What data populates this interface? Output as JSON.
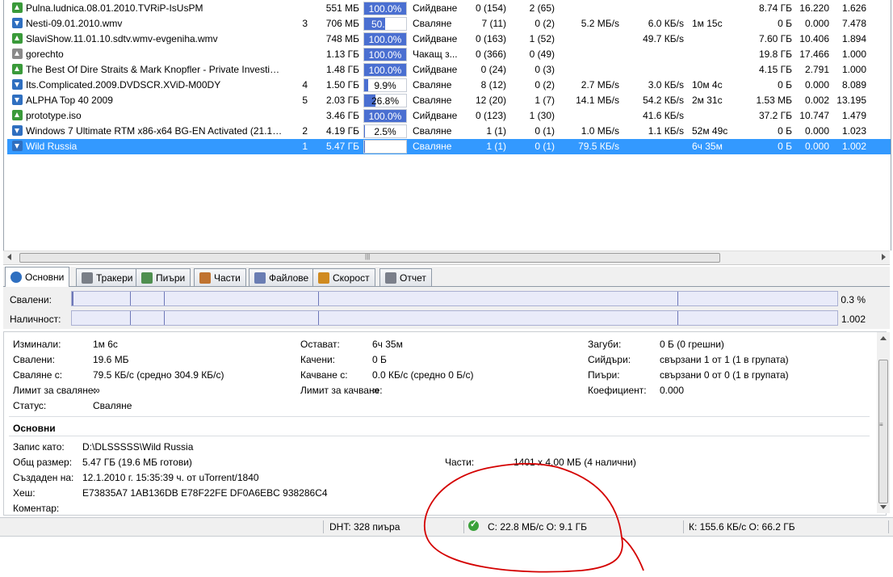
{
  "torrents": [
    {
      "icon": "seed",
      "name": "Pulna.ludnica.08.01.2010.TVRiP-IsUsPM",
      "num": "",
      "size": "551 МБ",
      "progress": "100.0%",
      "progress_pct": 100,
      "status": "Сийдване",
      "seeds": "0 (154)",
      "peers": "2 (65)",
      "dl": "",
      "ul": "",
      "eta": "",
      "downloaded": "8.74 ГБ",
      "uploaded": "16.220",
      "ratio": "1.626"
    },
    {
      "icon": "down",
      "name": "Nesti-09.01.2010.wmv",
      "num": "3",
      "size": "706 МБ",
      "progress": "50.2%",
      "progress_pct": 50.2,
      "status": "Сваляне",
      "seeds": "7 (11)",
      "peers": "0 (2)",
      "dl": "5.2 МБ/s",
      "ul": "6.0 КБ/s",
      "eta": "1м 15с",
      "downloaded": "0 Б",
      "uploaded": "0.000",
      "ratio": "7.478"
    },
    {
      "icon": "seed",
      "name": "SlaviShow.11.01.10.sdtv.wmv-evgeniha.wmv",
      "num": "",
      "size": "748 МБ",
      "progress": "100.0%",
      "progress_pct": 100,
      "status": "Сийдване",
      "seeds": "0 (163)",
      "peers": "1 (52)",
      "dl": "",
      "ul": "49.7 КБ/s",
      "eta": "",
      "downloaded": "7.60 ГБ",
      "uploaded": "10.406",
      "ratio": "1.894"
    },
    {
      "icon": "stop",
      "name": "gorechto",
      "num": "",
      "size": "1.13 ГБ",
      "progress": "100.0%",
      "progress_pct": 100,
      "status": "Чакащ з...",
      "seeds": "0 (366)",
      "peers": "0 (49)",
      "dl": "",
      "ul": "",
      "eta": "",
      "downloaded": "19.8 ГБ",
      "uploaded": "17.466",
      "ratio": "1.000"
    },
    {
      "icon": "seed",
      "name": "The Best Of Dire Straits & Mark Knopfler - Private Investiga...",
      "num": "",
      "size": "1.48 ГБ",
      "progress": "100.0%",
      "progress_pct": 100,
      "status": "Сийдване",
      "seeds": "0 (24)",
      "peers": "0 (3)",
      "dl": "",
      "ul": "",
      "eta": "",
      "downloaded": "4.15 ГБ",
      "uploaded": "2.791",
      "ratio": "1.000"
    },
    {
      "icon": "down",
      "name": "Its.Complicated.2009.DVDSCR.XViD-M00DY",
      "num": "4",
      "size": "1.50 ГБ",
      "progress": "9.9%",
      "progress_pct": 9.9,
      "status": "Сваляне",
      "seeds": "8 (12)",
      "peers": "0 (2)",
      "dl": "2.7 МБ/s",
      "ul": "3.0 КБ/s",
      "eta": "10м 4с",
      "downloaded": "0 Б",
      "uploaded": "0.000",
      "ratio": "8.089"
    },
    {
      "icon": "down",
      "name": "ALPHA Top 40 2009",
      "num": "5",
      "size": "2.03 ГБ",
      "progress": "26.8%",
      "progress_pct": 26.8,
      "status": "Сваляне",
      "seeds": "12 (20)",
      "peers": "1 (7)",
      "dl": "14.1 МБ/s",
      "ul": "54.2 КБ/s",
      "eta": "2м 31с",
      "downloaded": "1.53 МБ",
      "uploaded": "0.002",
      "ratio": "13.195"
    },
    {
      "icon": "seed",
      "name": "prototype.iso",
      "num": "",
      "size": "3.46 ГБ",
      "progress": "100.0%",
      "progress_pct": 100,
      "status": "Сийдване",
      "seeds": "0 (123)",
      "peers": "1 (30)",
      "dl": "",
      "ul": "41.6 КБ/s",
      "eta": "",
      "downloaded": "37.2 ГБ",
      "uploaded": "10.747",
      "ratio": "1.479"
    },
    {
      "icon": "down",
      "name": "Windows 7 Ultimate RTM x86-x64 BG-EN Activated (21.12....",
      "num": "2",
      "size": "4.19 ГБ",
      "progress": "2.5%",
      "progress_pct": 2.5,
      "status": "Сваляне",
      "seeds": "1 (1)",
      "peers": "0 (1)",
      "dl": "1.0 МБ/s",
      "ul": "1.1 КБ/s",
      "eta": "52м 49с",
      "downloaded": "0 Б",
      "uploaded": "0.000",
      "ratio": "1.023"
    },
    {
      "icon": "down",
      "name": "Wild Russia",
      "num": "1",
      "size": "5.47 ГБ",
      "progress": "0.3%",
      "progress_pct": 0.3,
      "status": "Сваляне",
      "seeds": "1 (1)",
      "peers": "0 (1)",
      "dl": "79.5 КБ/s",
      "ul": "",
      "eta": "6ч 35м",
      "downloaded": "0 Б",
      "uploaded": "0.000",
      "ratio": "1.002",
      "selected": true
    }
  ],
  "tabs": [
    {
      "label": "Основни",
      "icon": "info-icon",
      "active": true
    },
    {
      "label": "Тракери",
      "icon": "trackers-icon"
    },
    {
      "label": "Пиъри",
      "icon": "peers-icon"
    },
    {
      "label": "Части",
      "icon": "pieces-icon"
    },
    {
      "label": "Файлове",
      "icon": "files-icon"
    },
    {
      "label": "Скорост",
      "icon": "speed-icon"
    },
    {
      "label": "Отчет",
      "icon": "log-icon"
    }
  ],
  "bars": {
    "downloaded_label": "Свалени:",
    "downloaded_value": "0.3 %",
    "availability_label": "Наличност:",
    "availability_value": "1.002"
  },
  "transfer": {
    "elapsed_label": "Изминали:",
    "elapsed": "1м 6с",
    "downloaded_label": "Свалени:",
    "downloaded": "19.6 МБ",
    "dl_speed_label": "Сваляне с:",
    "dl_speed": "79.5 КБ/с (средно 304.9 КБ/с)",
    "dl_limit_label": "Лимит за сваляне:",
    "dl_limit": "∞",
    "status_label": "Статус:",
    "status": "Сваляне",
    "remaining_label": "Остават:",
    "remaining": "6ч 35м",
    "uploaded_label": "Качени:",
    "uploaded": "0 Б",
    "ul_speed_label": "Качване с:",
    "ul_speed": "0.0 КБ/с (средно 0 Б/с)",
    "ul_limit_label": "Лимит за качване:",
    "ul_limit": "∞",
    "wasted_label": "Загуби:",
    "wasted": "0 Б (0 грешни)",
    "seeds_label": "Сийдъри:",
    "seeds": "свързани 1 от 1 (1 в групата)",
    "peers_label": "Пиъри:",
    "peers": "свързани 0 от 0 (1 в групата)",
    "ratio_label": "Коефициент:",
    "ratio": "0.000"
  },
  "general": {
    "heading": "Основни",
    "save_as_label": "Запис като:",
    "save_as": "D:\\DLSSSSS\\Wild Russia",
    "total_size_label": "Общ размер:",
    "total_size": "5.47 ГБ (19.6 МБ готови)",
    "created_label": "Създаден на:",
    "created": "12.1.2010 г. 15:35:39 ч. от uTorrent/1840",
    "hash_label": "Хеш:",
    "hash": "E73835A7 1AB136DB E78F22FE DF0A6EBC 938286C4",
    "comment_label": "Коментар:",
    "pieces_label": "Части:",
    "pieces": "1401 x 4.00 МБ (4 налични)"
  },
  "statusbar": {
    "dht": "DHT: 328 пиъра",
    "network": "С: 22.8 МБ/с О: 9.1 ГБ",
    "totals": "К: 155.6 КБ/с О: 66.2 ГБ"
  },
  "colors": {
    "selection": "#3399ff",
    "progress": "#4a6fd1",
    "annotation": "#cc0000"
  }
}
